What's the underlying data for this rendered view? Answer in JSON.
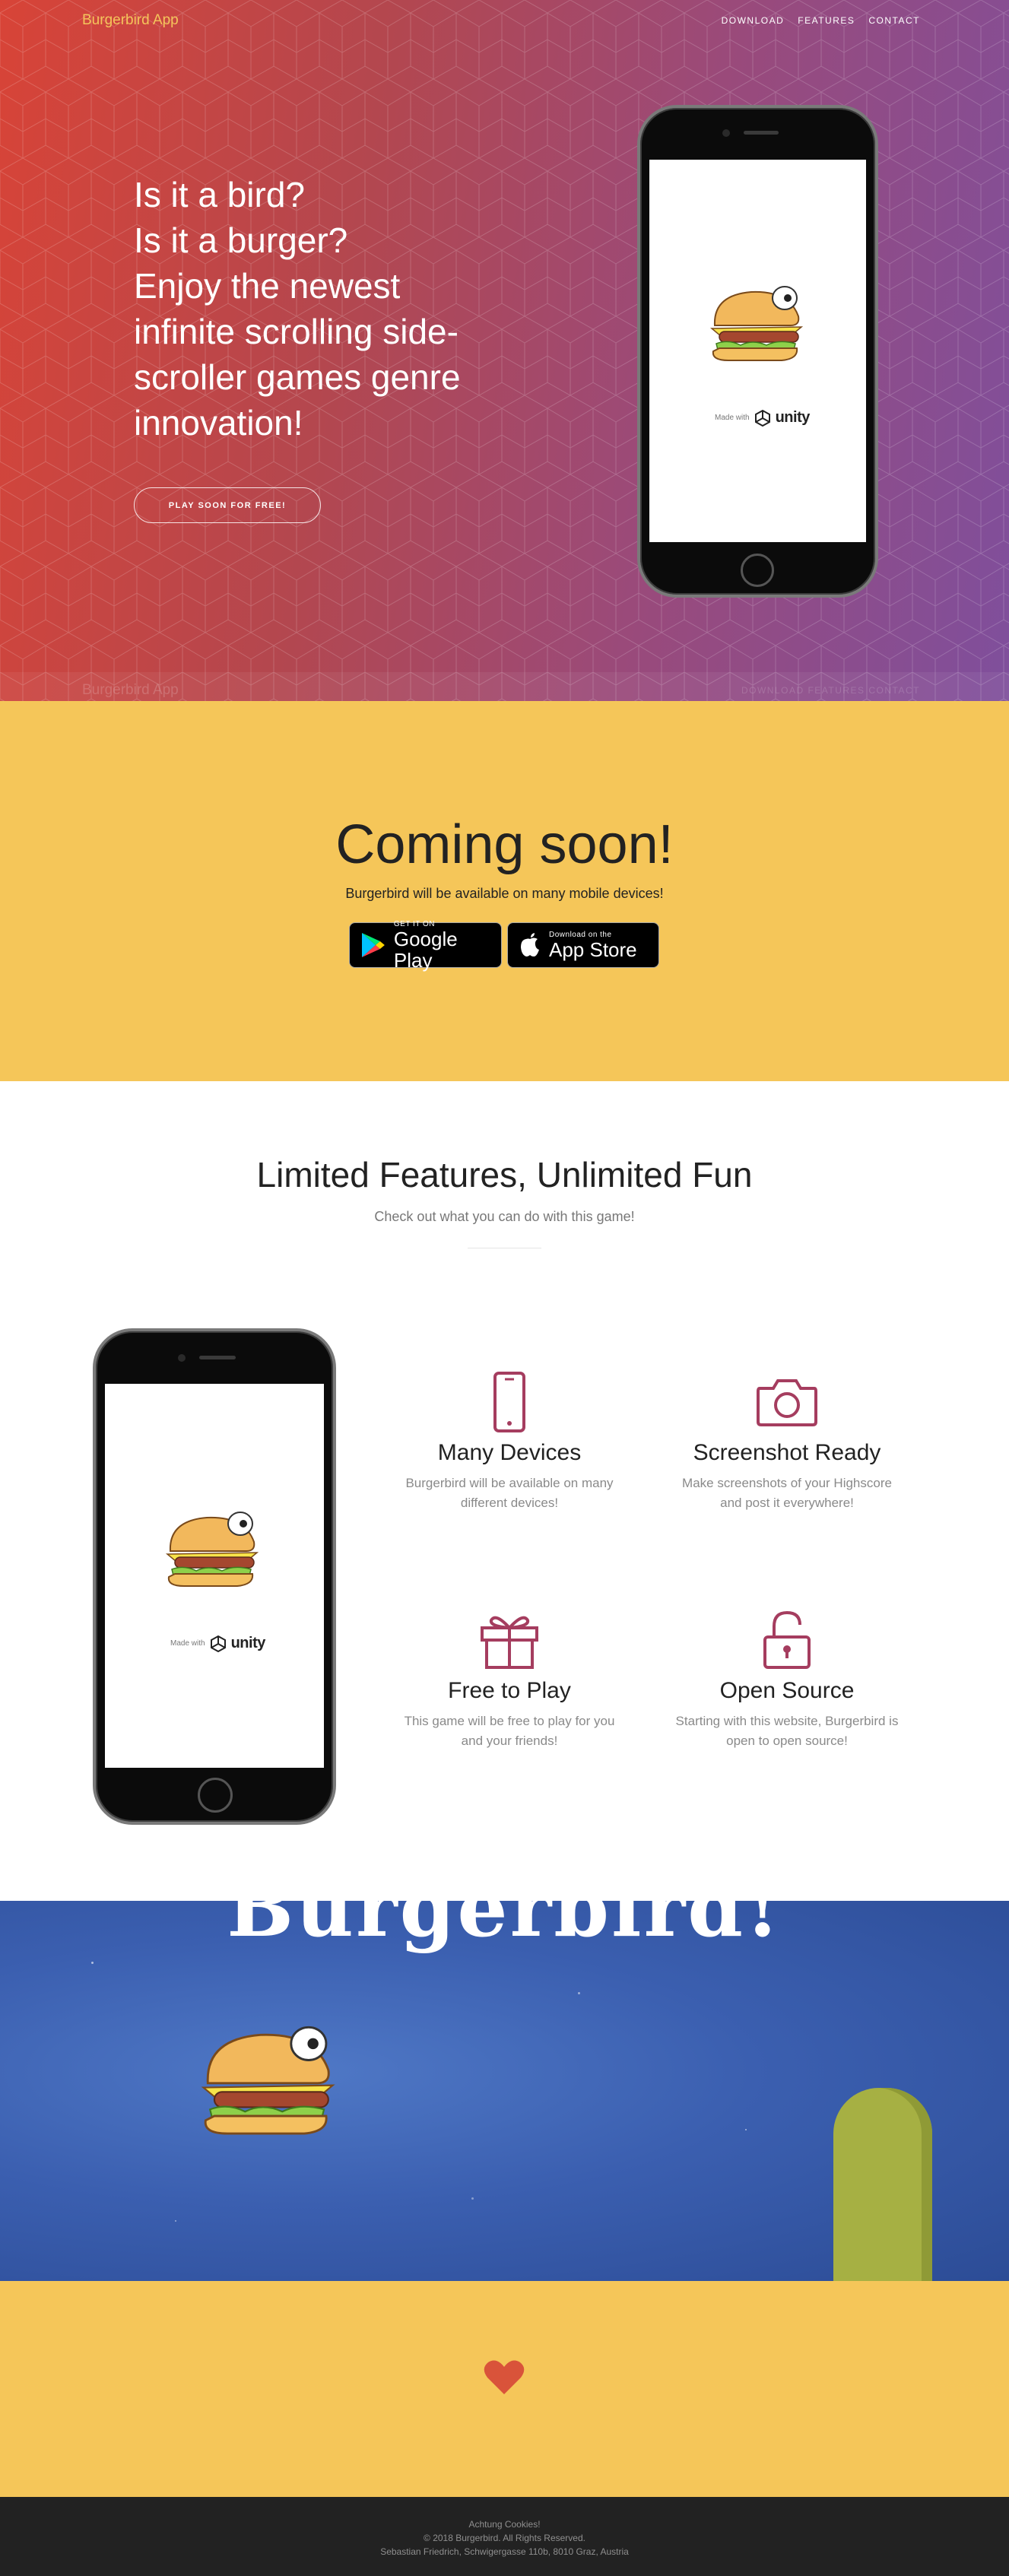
{
  "nav": {
    "brand": "Burgerbird App",
    "links": [
      "DOWNLOAD",
      "FEATURES",
      "CONTACT"
    ]
  },
  "hero": {
    "heading_lines": [
      "Is it a bird?",
      "Is it a burger?",
      "Enjoy the newest",
      "infinite scrolling side-",
      "scroller games genre",
      "innovation!"
    ],
    "cta_label": "PLAY SOON FOR FREE!",
    "ghost_brand": "Burgerbird App",
    "ghost_links": "DOWNLOAD  FEATURES  CONTACT",
    "made_with": "Made with",
    "unity": "unity"
  },
  "coming": {
    "title": "Coming soon!",
    "subtitle": "Burgerbird will be available on many mobile devices!",
    "google": {
      "small": "GET IT ON",
      "big": "Google Play"
    },
    "apple": {
      "small": "Download on the",
      "big": "App Store"
    }
  },
  "features": {
    "title": "Limited Features, Unlimited Fun",
    "subtitle": "Check out what you can do with this game!",
    "items": [
      {
        "icon": "phone-icon",
        "title": "Many Devices",
        "text": "Burgerbird will be available on many different devices!"
      },
      {
        "icon": "camera-icon",
        "title": "Screenshot Ready",
        "text": "Make screenshots of your Highscore and post it everywhere!"
      },
      {
        "icon": "gift-icon",
        "title": "Free to Play",
        "text": "This game will be free to play for you and your friends!"
      },
      {
        "icon": "unlock-icon",
        "title": "Open Source",
        "text": "Starting with this website, Burgerbird is open to open source!"
      }
    ]
  },
  "game": {
    "title": "Burgerbird!"
  },
  "footer": {
    "line1": "Achtung Cookies!",
    "line2": "© 2018 Burgerbird. All Rights Reserved.",
    "line3": "Sebastian Friedrich, Schwigergasse 110b, 8010 Graz, Austria"
  },
  "colors": {
    "accent": "#f5c659",
    "brand": "#f4c55b",
    "feature_icon": "#a53d5f",
    "heart": "#d9533a",
    "footer": "#222222"
  }
}
